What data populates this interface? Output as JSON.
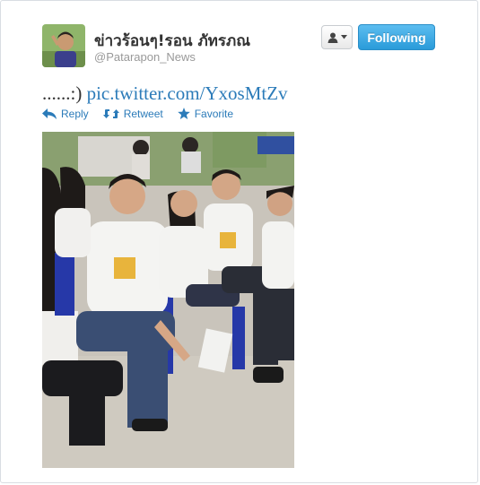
{
  "tweet": {
    "display_name": "ข่าวร้อนๆ!รอน ภัทรภณ",
    "handle": "@Patarapon_News",
    "text_prefix": "......:) ",
    "link_text": "pic.twitter.com/YxosMtZv"
  },
  "buttons": {
    "following_label": "Following"
  },
  "actions": {
    "reply_label": "Reply",
    "retweet_label": "Retweet",
    "favorite_label": "Favorite"
  },
  "colors": {
    "link": "#2b7bb9",
    "follow_button": "#2a9bd9",
    "icon": "#2b7bb9"
  },
  "icons": [
    "reply-icon",
    "retweet-icon",
    "star-icon",
    "person-icon",
    "caret-down-icon"
  ]
}
